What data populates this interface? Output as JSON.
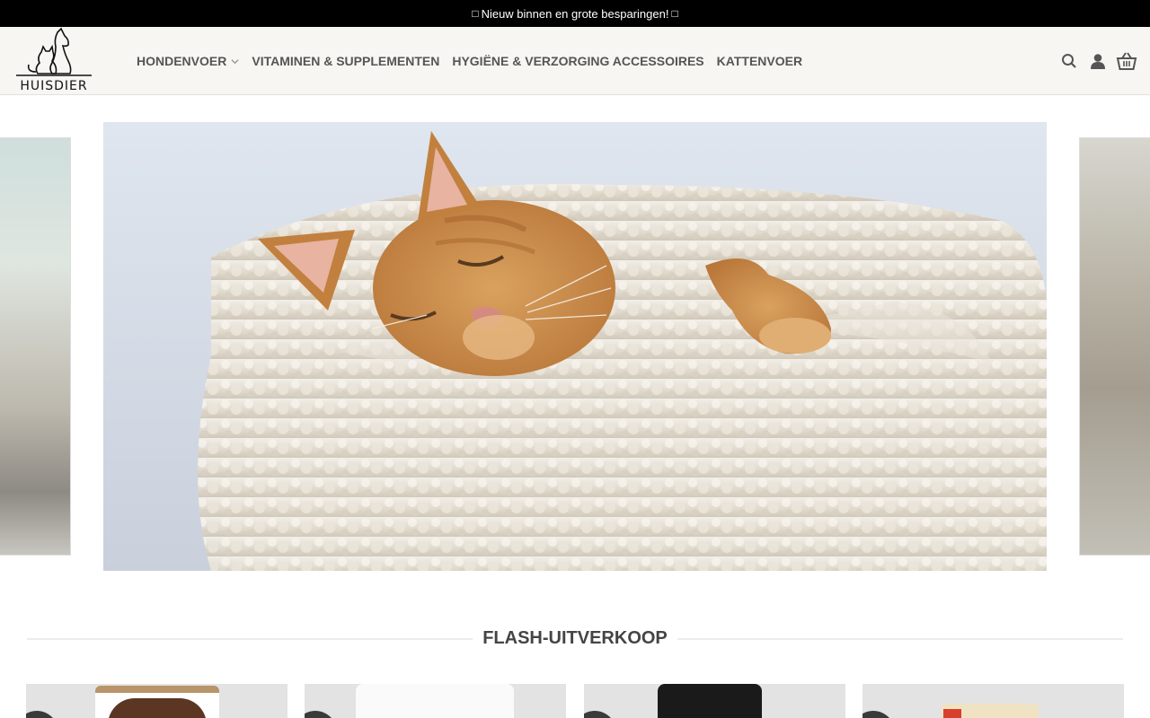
{
  "topbar": {
    "text": "Nieuw binnen en grote besparingen!"
  },
  "logo": {
    "text": "HUISDIER"
  },
  "nav": {
    "items": [
      {
        "label": "HONDENVOER",
        "has_dropdown": true
      },
      {
        "label": "VITAMINEN & SUPPLEMENTEN",
        "has_dropdown": false
      },
      {
        "label": "HYGIËNE & VERZORGING ACCESSOIRES",
        "has_dropdown": false
      },
      {
        "label": "KATTENVOER",
        "has_dropdown": false
      }
    ]
  },
  "header_icons": [
    "search-icon",
    "account-icon",
    "cart-icon"
  ],
  "section": {
    "title": "FLASH-UITVERKOOP"
  },
  "colors": {
    "topbar": "#000000",
    "header_bg": "#f7f6f2",
    "nav_text": "#555555",
    "card_bg": "#e3e3e3"
  }
}
